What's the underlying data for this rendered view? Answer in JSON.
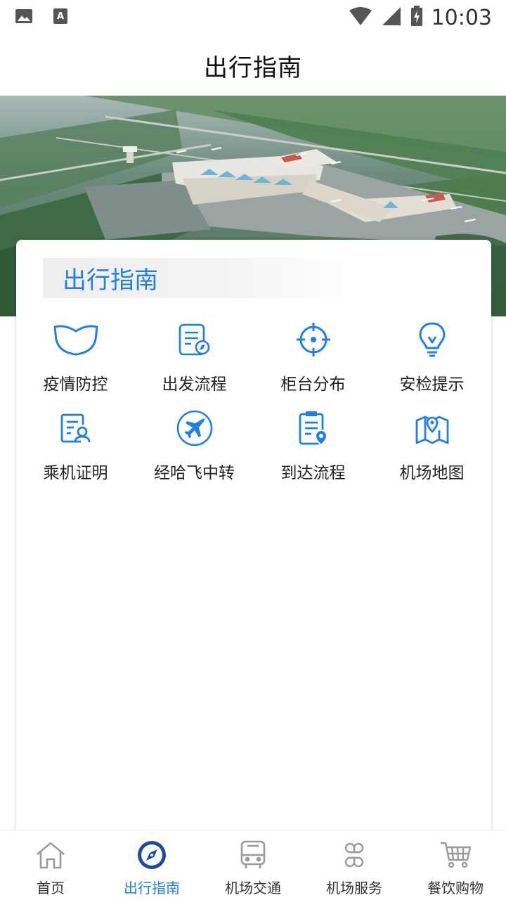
{
  "status_bar": {
    "time": "10:03",
    "icons": [
      "image-icon",
      "text-a-icon",
      "wifi-icon",
      "cell-signal-icon",
      "battery-charging-icon"
    ]
  },
  "header": {
    "title": "出行指南"
  },
  "banner": {
    "image": "airport-aerial-photo"
  },
  "section": {
    "title": "出行指南",
    "accent_color": "#1f7fe6",
    "items": [
      {
        "label": "疫情防控",
        "icon": "mask-icon"
      },
      {
        "label": "出发流程",
        "icon": "departure-doc-icon"
      },
      {
        "label": "柜台分布",
        "icon": "crosshair-icon"
      },
      {
        "label": "安检提示",
        "icon": "lightbulb-icon"
      },
      {
        "label": "乘机证明",
        "icon": "certificate-icon"
      },
      {
        "label": "经哈飞中转",
        "icon": "airplane-icon"
      },
      {
        "label": "到达流程",
        "icon": "arrival-clipboard-icon"
      },
      {
        "label": "机场地图",
        "icon": "map-icon"
      }
    ]
  },
  "bottom_nav": {
    "active_index": 1,
    "items": [
      {
        "label": "首页",
        "icon": "home-icon"
      },
      {
        "label": "出行指南",
        "icon": "compass-icon"
      },
      {
        "label": "机场交通",
        "icon": "bus-icon"
      },
      {
        "label": "机场服务",
        "icon": "services-icon"
      },
      {
        "label": "餐饮购物",
        "icon": "cart-icon"
      }
    ]
  }
}
